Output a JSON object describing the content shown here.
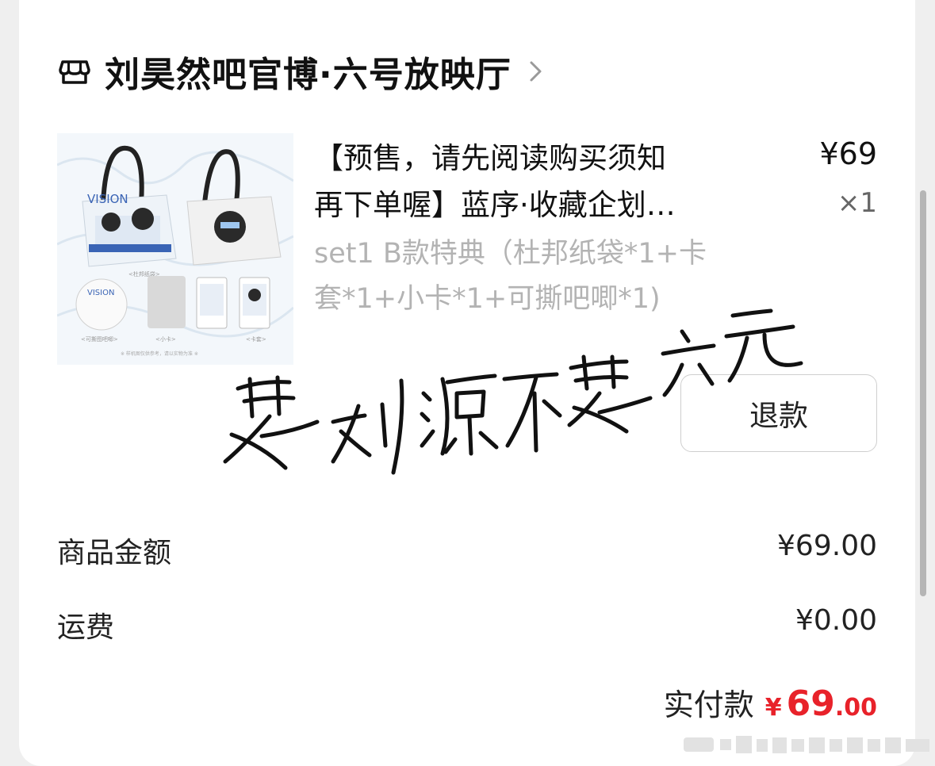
{
  "shop": {
    "icon": "store-icon",
    "name": "刘昊然吧官博·六号放映厅",
    "chevron_icon": "chevron-right-icon"
  },
  "product": {
    "title_line1": "【预售，请先阅读购买须知",
    "title_line2": "再下单喔】蓝序·收藏企划…",
    "spec_line1": "set1 B款特典（杜邦纸袋*1+卡",
    "spec_line2": "套*1+小卡*1+可撕吧唧*1)",
    "price": "¥69",
    "quantity": "×1",
    "thumbnail": {
      "brand_text": "VISION",
      "captions": [
        "<杜邦纸袋>",
        "<可撕图吧唧>",
        "<小卡>",
        "<卡套>"
      ],
      "footnote": "※ 样机图仅供参考，请以实物为准 ※"
    }
  },
  "refund_button": {
    "label": "退款"
  },
  "summary": {
    "goods_amount_label": "商品金额",
    "goods_amount_value": "¥69.00",
    "shipping_label": "运费",
    "shipping_value": "¥0.00",
    "paid_label": "实付款",
    "paid_currency": "¥",
    "paid_integer": "69",
    "paid_decimal": ".00"
  },
  "signature_text": "要刘源不要六元",
  "colors": {
    "accent_red": "#e8222a",
    "muted_text": "#b3b3b3",
    "background": "#efefef",
    "card": "#ffffff"
  }
}
